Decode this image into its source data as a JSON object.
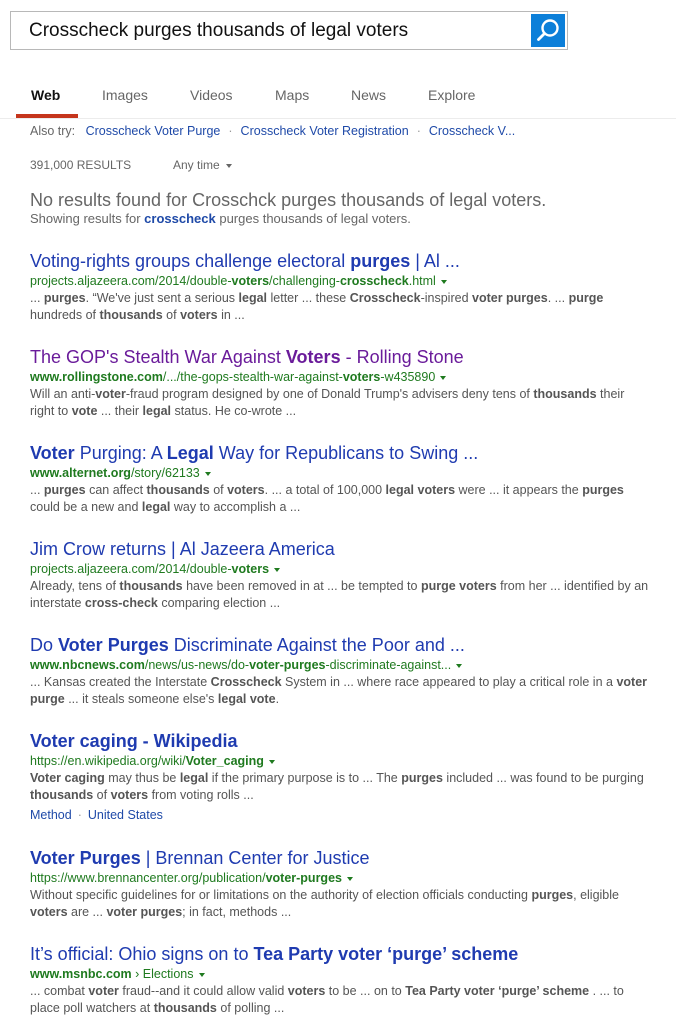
{
  "search": {
    "query": "Crosscheck purges thousands of legal voters"
  },
  "tabs": [
    "Web",
    "Images",
    "Videos",
    "Maps",
    "News",
    "Explore"
  ],
  "also_try": {
    "label": "Also try:",
    "items": [
      "Crosscheck Voter Purge",
      "Crosscheck Voter Registration",
      "Crosscheck V..."
    ]
  },
  "results_count": "391,000 RESULTS",
  "time_filter": "Any time",
  "no_results": "No results found for Crosschck purges thousands of legal voters.",
  "showing": {
    "prefix": "Showing results for ",
    "bold": "crosscheck",
    "rest": " purges thousands of legal voters."
  },
  "results": [
    {
      "title": [
        [
          "Voting-rights groups challenge electoral ",
          0
        ],
        [
          "purges",
          1
        ],
        [
          " | Al ...",
          0
        ]
      ],
      "url": [
        [
          "projects.aljazeera.com/2014/double-",
          0
        ],
        [
          "voters",
          1
        ],
        [
          "/challenging-",
          0
        ],
        [
          "crosscheck",
          1
        ],
        [
          ".html",
          0
        ]
      ],
      "snippet": [
        [
          "... ",
          0
        ],
        [
          "purges",
          1
        ],
        [
          ". “We've just sent a serious ",
          0
        ],
        [
          "legal",
          1
        ],
        [
          " letter ... these ",
          0
        ],
        [
          "Crosscheck",
          1
        ],
        [
          "-inspired ",
          0
        ],
        [
          "voter purges",
          1
        ],
        [
          ". ... ",
          0
        ],
        [
          "purge",
          1
        ],
        [
          " hundreds of ",
          0
        ],
        [
          "thousands",
          1
        ],
        [
          " of ",
          0
        ],
        [
          "voters",
          1
        ],
        [
          " in ...",
          0
        ]
      ]
    },
    {
      "title": [
        [
          "The GOP's Stealth War Against ",
          0
        ],
        [
          "Voters",
          1
        ],
        [
          " - Rolling Stone",
          0
        ]
      ],
      "visited": true,
      "url": [
        [
          "www.rollingstone.com",
          1
        ],
        [
          "/.../the-gops-stealth-war-against-",
          0
        ],
        [
          "voters",
          1
        ],
        [
          "-w435890",
          0
        ]
      ],
      "snippet": [
        [
          "Will an anti-",
          0
        ],
        [
          "voter",
          1
        ],
        [
          "-fraud program designed by one of Donald Trump's advisers deny tens of ",
          0
        ],
        [
          "thousands",
          1
        ],
        [
          " their right to ",
          0
        ],
        [
          "vote",
          1
        ],
        [
          " ... their ",
          0
        ],
        [
          "legal",
          1
        ],
        [
          " status. He co-wrote ...",
          0
        ]
      ]
    },
    {
      "title": [
        [
          "Voter",
          1
        ],
        [
          " Purging: A ",
          0
        ],
        [
          "Legal",
          1
        ],
        [
          " Way for Republicans to Swing ...",
          0
        ]
      ],
      "url": [
        [
          "www.alternet.org",
          1
        ],
        [
          "/story/62133",
          0
        ]
      ],
      "snippet": [
        [
          "... ",
          0
        ],
        [
          "purges",
          1
        ],
        [
          " can affect ",
          0
        ],
        [
          "thousands",
          1
        ],
        [
          " of ",
          0
        ],
        [
          "voters",
          1
        ],
        [
          ". ... a total of 100,000 ",
          0
        ],
        [
          "legal voters",
          1
        ],
        [
          " were ... it appears the ",
          0
        ],
        [
          "purges",
          1
        ],
        [
          " could be a new and ",
          0
        ],
        [
          "legal",
          1
        ],
        [
          " way to accomplish a ...",
          0
        ]
      ]
    },
    {
      "title": [
        [
          "Jim Crow returns | Al Jazeera America",
          0
        ]
      ],
      "url": [
        [
          "projects.aljazeera.com/2014/double-",
          0
        ],
        [
          "voters",
          1
        ]
      ],
      "snippet": [
        [
          "Already, tens of ",
          0
        ],
        [
          "thousands",
          1
        ],
        [
          " have been removed in at ... be tempted to ",
          0
        ],
        [
          "purge voters",
          1
        ],
        [
          " from her ... identified by an interstate ",
          0
        ],
        [
          "cross-check",
          1
        ],
        [
          " comparing election ...",
          0
        ]
      ]
    },
    {
      "title": [
        [
          "Do ",
          0
        ],
        [
          "Voter Purges",
          1
        ],
        [
          " Discriminate Against the Poor and ...",
          0
        ]
      ],
      "url": [
        [
          "www.nbcnews.com",
          1
        ],
        [
          "/news/us-news/do-",
          0
        ],
        [
          "voter-purges",
          1
        ],
        [
          "-discriminate-against...",
          0
        ]
      ],
      "snippet": [
        [
          "... Kansas created the Interstate ",
          0
        ],
        [
          "Crosscheck",
          1
        ],
        [
          " System in ... where race appeared to play a critical role in a ",
          0
        ],
        [
          "voter purge",
          1
        ],
        [
          " ... it steals someone else's ",
          0
        ],
        [
          "legal vote",
          1
        ],
        [
          ".",
          0
        ]
      ]
    },
    {
      "title": [
        [
          "Voter caging - Wikipedia",
          1
        ]
      ],
      "url": [
        [
          "https://en.wikipedia.org/wiki/",
          0
        ],
        [
          "Voter_caging",
          1
        ]
      ],
      "snippet": [
        [
          "Voter caging",
          1
        ],
        [
          " may thus be ",
          0
        ],
        [
          "legal",
          1
        ],
        [
          " if the primary purpose is to ... The ",
          0
        ],
        [
          "purges",
          1
        ],
        [
          " included ... was found to be purging ",
          0
        ],
        [
          "thousands",
          1
        ],
        [
          " of ",
          0
        ],
        [
          "voters",
          1
        ],
        [
          " from voting rolls ...",
          0
        ]
      ],
      "deeplinks": [
        "Method",
        "United States"
      ]
    },
    {
      "title": [
        [
          "Voter Purges",
          1
        ],
        [
          " | Brennan Center for Justice",
          0
        ]
      ],
      "url": [
        [
          "https://www.brennancenter.org/publication/",
          0
        ],
        [
          "voter-purges",
          1
        ]
      ],
      "snippet": [
        [
          "Without specific guidelines for or limitations on the authority of election officials conducting ",
          0
        ],
        [
          "purges",
          1
        ],
        [
          ", eligible ",
          0
        ],
        [
          "voters",
          1
        ],
        [
          " are ... ",
          0
        ],
        [
          "voter purges",
          1
        ],
        [
          "; in fact, methods ...",
          0
        ]
      ]
    },
    {
      "title": [
        [
          "It’s official: Ohio signs on to ",
          0
        ],
        [
          "Tea Party voter ‘purge’ scheme",
          1
        ]
      ],
      "url": [
        [
          "www.msnbc.com",
          1
        ],
        [
          " › Elections",
          0
        ]
      ],
      "snippet": [
        [
          "... combat ",
          0
        ],
        [
          "voter",
          1
        ],
        [
          " fraud--and it could allow valid ",
          0
        ],
        [
          "voters",
          1
        ],
        [
          " to be ... on to ",
          0
        ],
        [
          "Tea Party voter ‘purge’ scheme",
          1
        ],
        [
          " . ... to place poll watchers at ",
          0
        ],
        [
          "thousands",
          1
        ],
        [
          " of polling ...",
          0
        ]
      ]
    }
  ],
  "colors": {
    "accent": "#0c7fd9",
    "tab_underline": "#c5351c",
    "link": "#1f3bb0",
    "visited": "#6a1b9a",
    "url": "#1f7a1f"
  }
}
